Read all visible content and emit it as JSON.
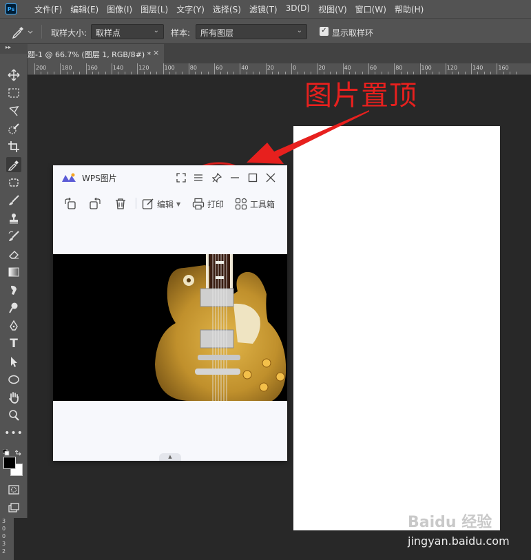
{
  "app": {
    "logo_text": "Ps"
  },
  "menu": [
    "文件(F)",
    "编辑(E)",
    "图像(I)",
    "图层(L)",
    "文字(Y)",
    "选择(S)",
    "滤镜(T)",
    "3D(D)",
    "视图(V)",
    "窗口(W)",
    "帮助(H)"
  ],
  "options": {
    "sample_size_label": "取样大小:",
    "sample_size_value": "取样点",
    "sample_label": "样本:",
    "sample_value": "所有图层",
    "show_ring_label": "显示取样环",
    "show_ring_checked": true
  },
  "document_tab": {
    "title": "题-1 @ 66.7% (图层 1, RGB/8#) *",
    "close_glyph": "×"
  },
  "ruler": {
    "labels": [
      "200",
      "180",
      "160",
      "140",
      "120",
      "100",
      "80",
      "60",
      "40",
      "20",
      "0",
      "20",
      "40",
      "60",
      "80",
      "100",
      "120",
      "140",
      "160"
    ],
    "vertical_labels": [
      "3",
      "0",
      "0",
      "3",
      "2"
    ]
  },
  "tools": [
    "move-tool-icon",
    "marquee-tool-icon",
    "lasso-tool-icon",
    "quick-select-tool-icon",
    "crop-tool-icon",
    "eyedropper-tool-icon",
    "patch-tool-icon",
    "brush-tool-icon",
    "stamp-tool-icon",
    "history-brush-tool-icon",
    "eraser-tool-icon",
    "gradient-tool-icon",
    "smudge-tool-icon",
    "dodge-tool-icon",
    "pen-tool-icon",
    "type-tool-icon",
    "path-select-tool-icon",
    "ellipse-tool-icon",
    "hand-tool-icon",
    "zoom-tool-icon",
    "more-tools-icon"
  ],
  "colors": {
    "foreground": "#000000",
    "background": "#ffffff",
    "annotation_red": "#e7201e",
    "ps_accent": "#31a8ff"
  },
  "annotation": {
    "text": "图片置顶"
  },
  "wps": {
    "title": "WPS图片",
    "toolbar": {
      "edit_label": "编辑",
      "print_label": "打印",
      "toolbox_label": "工具箱"
    }
  },
  "watermark": {
    "logo": "Baidu 经验",
    "url": "jingyan.baidu.com"
  }
}
